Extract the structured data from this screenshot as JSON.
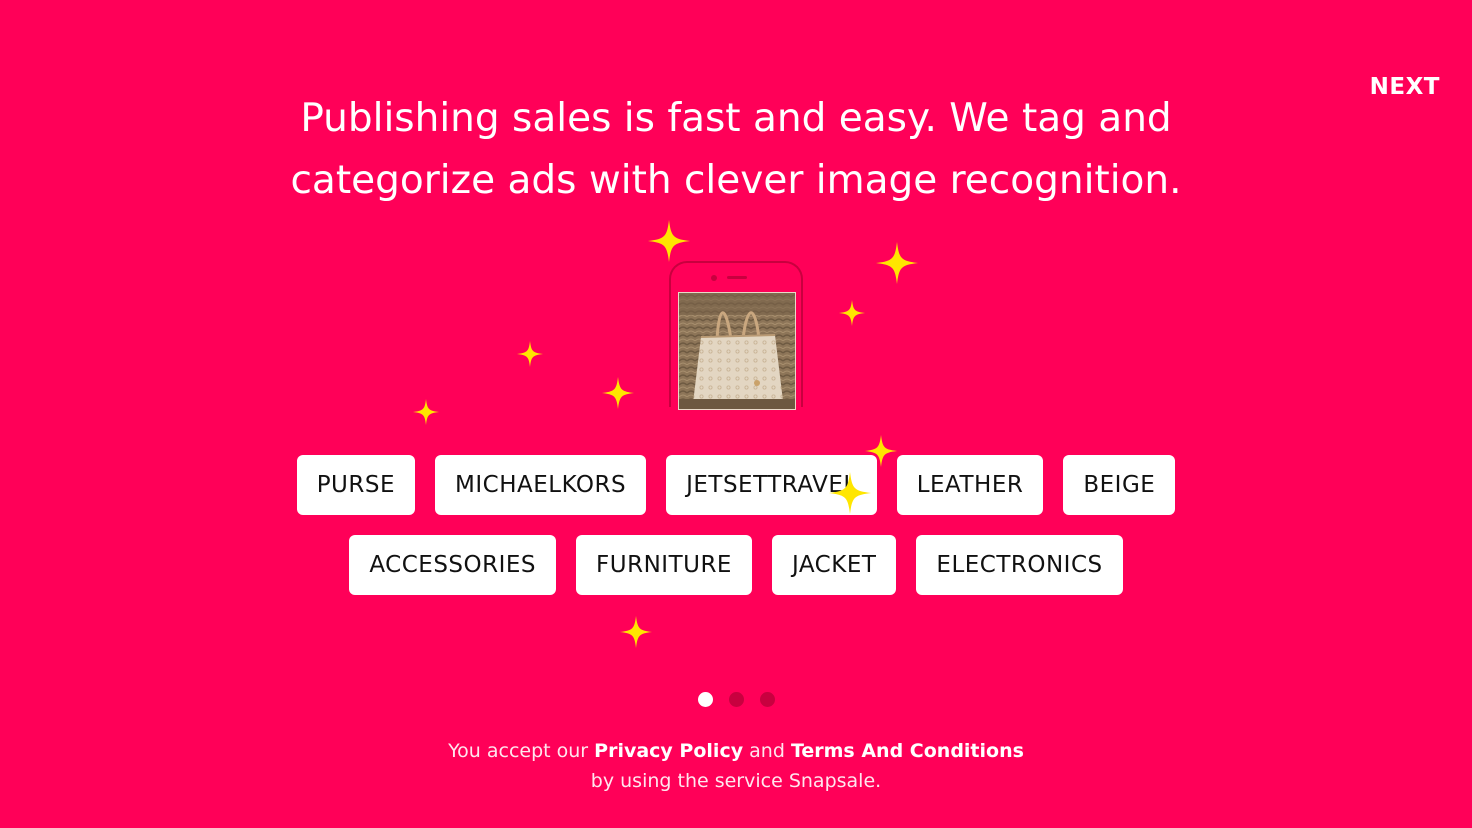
{
  "nav": {
    "next_label": "NEXT"
  },
  "headline": {
    "line1": "Publishing sales is fast and easy. We tag and",
    "line2": "categorize ads with clever image recognition."
  },
  "phone": {
    "image_icon": "purse-photo"
  },
  "tags": {
    "row1": [
      "PURSE",
      "MICHAELKORS",
      "JETSETTRAVEL",
      "LEATHER",
      "BEIGE"
    ],
    "row2": [
      "ACCESSORIES",
      "FURNITURE",
      "JACKET",
      "ELECTRONICS"
    ]
  },
  "pagination": {
    "total": 3,
    "active_index": 0
  },
  "footer": {
    "text1": "You accept our",
    "privacy_link": "Privacy Policy",
    "and": "and",
    "terms_link": "Terms And Conditions",
    "line2": "by using the service Snapsale."
  },
  "colors": {
    "background": "#ff0058",
    "sparkle": "#ffe600",
    "tag_background": "#ffffff",
    "dot_inactive": "#c8003f"
  }
}
